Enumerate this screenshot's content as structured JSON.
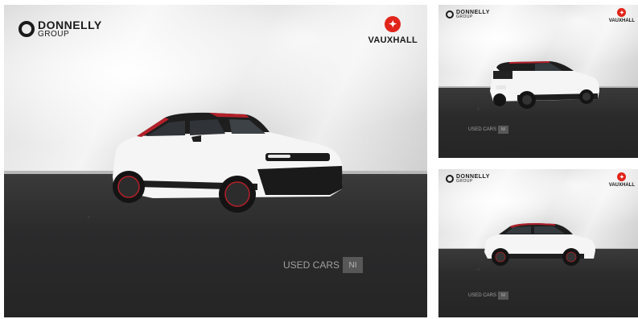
{
  "gallery": {
    "main": {
      "dealer_name": "DONNELLY",
      "dealer_sub": "GROUP",
      "maker_name": "VAUXHALL",
      "watermark_text": "USED CARS",
      "watermark_badge": "NI",
      "view": "front-three-quarter"
    },
    "thumbs": [
      {
        "dealer_name": "DONNELLY",
        "dealer_sub": "GROUP",
        "maker_name": "VAUXHALL",
        "watermark_text": "USED CARS",
        "watermark_badge": "NI",
        "view": "rear-three-quarter"
      },
      {
        "dealer_name": "DONNELLY",
        "dealer_sub": "GROUP",
        "maker_name": "VAUXHALL",
        "watermark_text": "USED CARS",
        "watermark_badge": "NI",
        "view": "side-profile"
      }
    ]
  },
  "colors": {
    "car_body": "#f5f5f5",
    "car_roof_accent": "#b3202a",
    "brand_red": "#e1251b",
    "floor": "#2b2b2c"
  }
}
